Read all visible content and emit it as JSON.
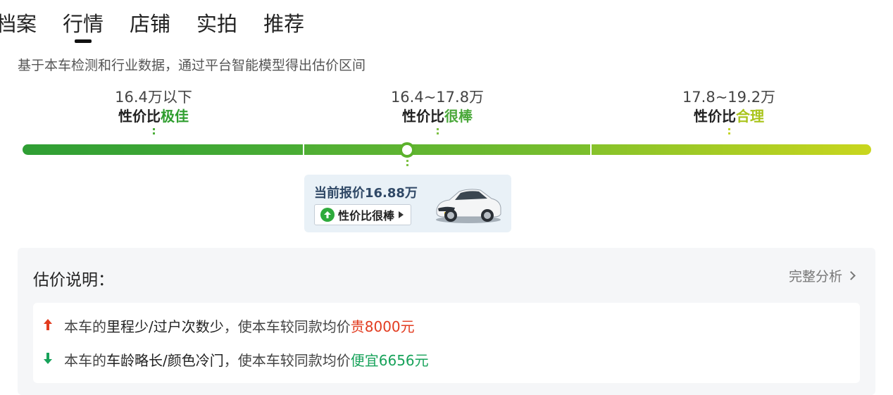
{
  "tabs": [
    {
      "label": "档案",
      "active": false
    },
    {
      "label": "行情",
      "active": true
    },
    {
      "label": "店铺",
      "active": false
    },
    {
      "label": "实拍",
      "active": false
    },
    {
      "label": "推荐",
      "active": false
    }
  ],
  "description": "基于本车检测和行业数据，通过平台智能模型得出估价区间",
  "ranges": [
    {
      "price": "16.4万以下",
      "verdict_prefix": "性价比",
      "verdict": "极佳",
      "color": "#3aa835"
    },
    {
      "price": "16.4~17.8万",
      "verdict_prefix": "性价比",
      "verdict": "很棒",
      "color": "#5cb22c"
    },
    {
      "price": "17.8~19.2万",
      "verdict_prefix": "性价比",
      "verdict": "合理",
      "color": "#b3cc1a"
    }
  ],
  "current": {
    "label": "当前报价16.88万",
    "badge": "性价比很棒"
  },
  "explanation": {
    "title": "估价说明：",
    "link": "完整分析",
    "items": [
      {
        "direction": "up",
        "prefix": "本车的",
        "highlight": "里程少/过户次数少",
        "middle": "，使本车较同款均价",
        "result": "贵8000元",
        "result_color": "#e23b1f"
      },
      {
        "direction": "down",
        "prefix": "本车的",
        "highlight": "车龄略长/颜色冷门",
        "middle": "，使本车较同款均价",
        "result": "便宜6656元",
        "result_color": "#17a25a"
      }
    ]
  }
}
